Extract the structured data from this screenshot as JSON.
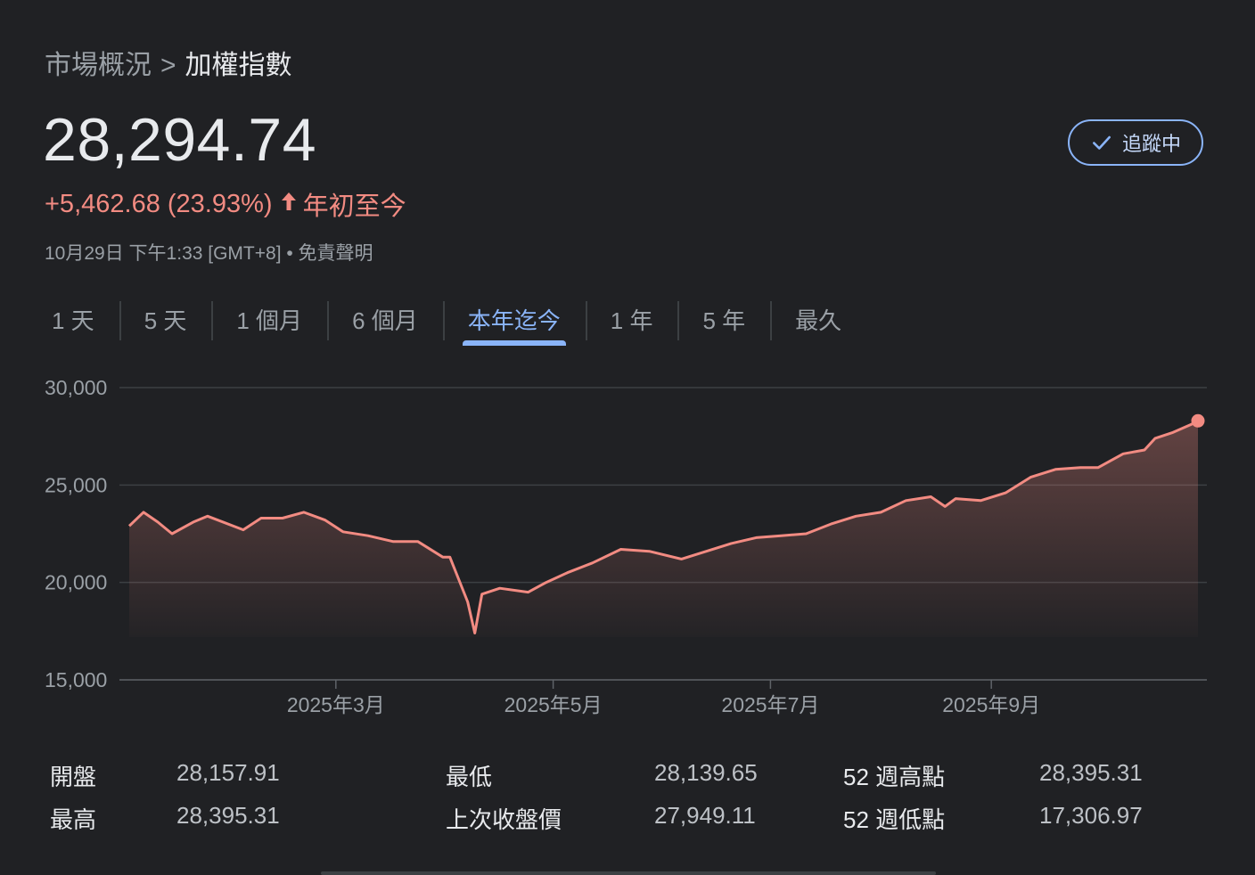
{
  "breadcrumb": {
    "parent": "市場概況",
    "separator": ">",
    "current": "加權指數"
  },
  "price": "28,294.74",
  "change": {
    "text": "+5,462.68 (23.93%)",
    "arrow": "↑",
    "period": "年初至今",
    "color": "#f28b82"
  },
  "timestamp": "10月29日 下午1:33 [GMT+8] • 免責聲明",
  "follow_button": {
    "label": "追蹤中",
    "icon": "check-icon"
  },
  "tabs": [
    {
      "label": "1 天",
      "active": false
    },
    {
      "label": "5 天",
      "active": false
    },
    {
      "label": "1 個月",
      "active": false
    },
    {
      "label": "6 個月",
      "active": false
    },
    {
      "label": "本年迄今",
      "active": true
    },
    {
      "label": "1 年",
      "active": false
    },
    {
      "label": "5 年",
      "active": false
    },
    {
      "label": "最久",
      "active": false
    }
  ],
  "chart_data": {
    "type": "area",
    "title": "",
    "xlabel": "",
    "ylabel": "",
    "ylim": [
      15000,
      30000
    ],
    "yticks": [
      30000,
      25000,
      20000,
      15000
    ],
    "ytick_labels": [
      "30,000",
      "25,000",
      "20,000",
      "15,000"
    ],
    "x_range": [
      "2025-01-02",
      "2025-10-29"
    ],
    "xticks": [
      "2025-03-01",
      "2025-05-01",
      "2025-07-01",
      "2025-09-01"
    ],
    "xtick_labels": [
      "2025年3月",
      "2025年5月",
      "2025年7月",
      "2025年9月"
    ],
    "grid": true,
    "line_color": "#f28b82",
    "series": [
      {
        "points": [
          [
            "2025-01-02",
            22900
          ],
          [
            "2025-01-06",
            23600
          ],
          [
            "2025-01-10",
            23100
          ],
          [
            "2025-01-14",
            22500
          ],
          [
            "2025-01-20",
            23100
          ],
          [
            "2025-01-24",
            23400
          ],
          [
            "2025-02-03",
            22700
          ],
          [
            "2025-02-08",
            23300
          ],
          [
            "2025-02-14",
            23300
          ],
          [
            "2025-02-20",
            23600
          ],
          [
            "2025-02-26",
            23200
          ],
          [
            "2025-03-03",
            22600
          ],
          [
            "2025-03-10",
            22400
          ],
          [
            "2025-03-17",
            22100
          ],
          [
            "2025-03-24",
            22100
          ],
          [
            "2025-03-31",
            21300
          ],
          [
            "2025-04-02",
            21300
          ],
          [
            "2025-04-07",
            19000
          ],
          [
            "2025-04-09",
            17400
          ],
          [
            "2025-04-11",
            19400
          ],
          [
            "2025-04-16",
            19700
          ],
          [
            "2025-04-24",
            19500
          ],
          [
            "2025-04-29",
            20000
          ],
          [
            "2025-05-05",
            20500
          ],
          [
            "2025-05-12",
            21000
          ],
          [
            "2025-05-20",
            21700
          ],
          [
            "2025-05-28",
            21600
          ],
          [
            "2025-06-06",
            21200
          ],
          [
            "2025-06-13",
            21600
          ],
          [
            "2025-06-20",
            22000
          ],
          [
            "2025-06-27",
            22300
          ],
          [
            "2025-07-04",
            22400
          ],
          [
            "2025-07-11",
            22500
          ],
          [
            "2025-07-18",
            23000
          ],
          [
            "2025-07-25",
            23400
          ],
          [
            "2025-08-01",
            23600
          ],
          [
            "2025-08-08",
            24200
          ],
          [
            "2025-08-15",
            24400
          ],
          [
            "2025-08-19",
            23900
          ],
          [
            "2025-08-22",
            24300
          ],
          [
            "2025-08-29",
            24200
          ],
          [
            "2025-09-05",
            24600
          ],
          [
            "2025-09-12",
            25400
          ],
          [
            "2025-09-19",
            25800
          ],
          [
            "2025-09-26",
            25900
          ],
          [
            "2025-10-01",
            25900
          ],
          [
            "2025-10-08",
            26600
          ],
          [
            "2025-10-14",
            26800
          ],
          [
            "2025-10-17",
            27400
          ],
          [
            "2025-10-22",
            27700
          ],
          [
            "2025-10-27",
            28100
          ],
          [
            "2025-10-29",
            28294.74
          ]
        ]
      }
    ]
  },
  "stats": [
    {
      "label": "開盤",
      "value": "28,157.91"
    },
    {
      "label": "最高",
      "value": "28,395.31"
    },
    {
      "label": "最低",
      "value": "28,139.65"
    },
    {
      "label": "上次收盤價",
      "value": "27,949.11"
    },
    {
      "label": "52 週高點",
      "value": "28,395.31"
    },
    {
      "label": "52 週低點",
      "value": "17,306.97"
    }
  ]
}
